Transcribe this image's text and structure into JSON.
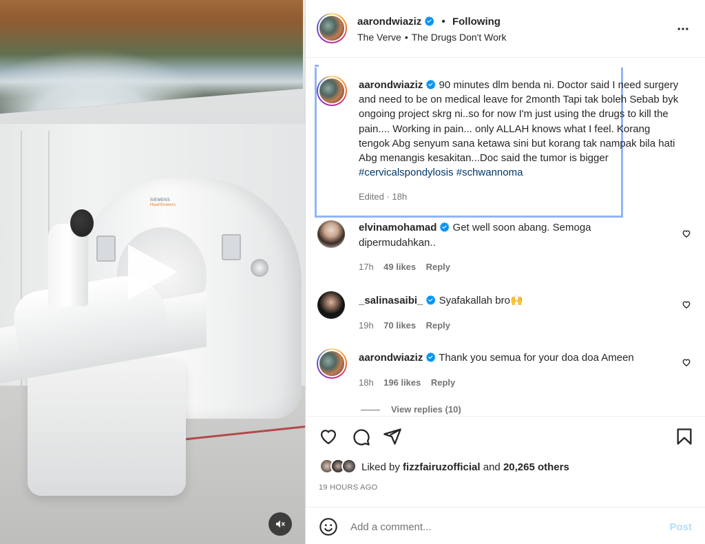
{
  "media": {
    "brand_line1": "SIEMENS",
    "brand_line2": "Healthineers",
    "play_icon": "play-icon",
    "mute_icon": "speaker-muted-icon"
  },
  "header": {
    "username": "aarondwiaziz",
    "follow_status": "Following",
    "song_artist": "The Verve",
    "song_title": "The Drugs Don't Work",
    "more_icon": "more-options-icon"
  },
  "caption": {
    "username": "aarondwiaziz",
    "text": "90 minutes dlm benda ni. Doctor said I need surgery and need to be on medical leave for 2month Tapi tak boleh Sebab byk ongoing project skrg ni..so for now I'm just using the drugs to kill the pain.... Working in pain... only ALLAH knows what I feel. Korang tengok Abg senyum sana ketawa sini but korang tak nampak bila hati Abg menangis kesakitan...Doc said the tumor is bigger",
    "hashtags": "#cervicalspondylosis #schwannoma",
    "edited": "Edited",
    "time": "18h"
  },
  "comments": [
    {
      "username": "elvinamohamad",
      "text": "Get well soon abang. Semoga dipermudahkan..",
      "time": "17h",
      "likes": "49 likes",
      "reply": "Reply"
    },
    {
      "username": "_salinasaibi_",
      "text": "Syafakallah bro🙌",
      "time": "19h",
      "likes": "70 likes",
      "reply": "Reply"
    },
    {
      "username": "aarondwiaziz",
      "text": "Thank you semua for your doa doa Ameen",
      "time": "18h",
      "likes": "196 likes",
      "reply": "Reply",
      "view_replies": "View replies (10)"
    }
  ],
  "actions": {
    "liked_by_prefix": "Liked by",
    "liked_by_user": "fizzfairuzofficial",
    "liked_by_and": "and",
    "liked_by_others": "20,265 others",
    "time_ago": "19 HOURS AGO"
  },
  "comment_box": {
    "placeholder": "Add a comment...",
    "post_label": "Post"
  },
  "colors": {
    "verified": "#0095f6",
    "hashtag": "#00376b",
    "post_disabled": "#b2dffc",
    "highlight_border": "#8fb5f8"
  }
}
